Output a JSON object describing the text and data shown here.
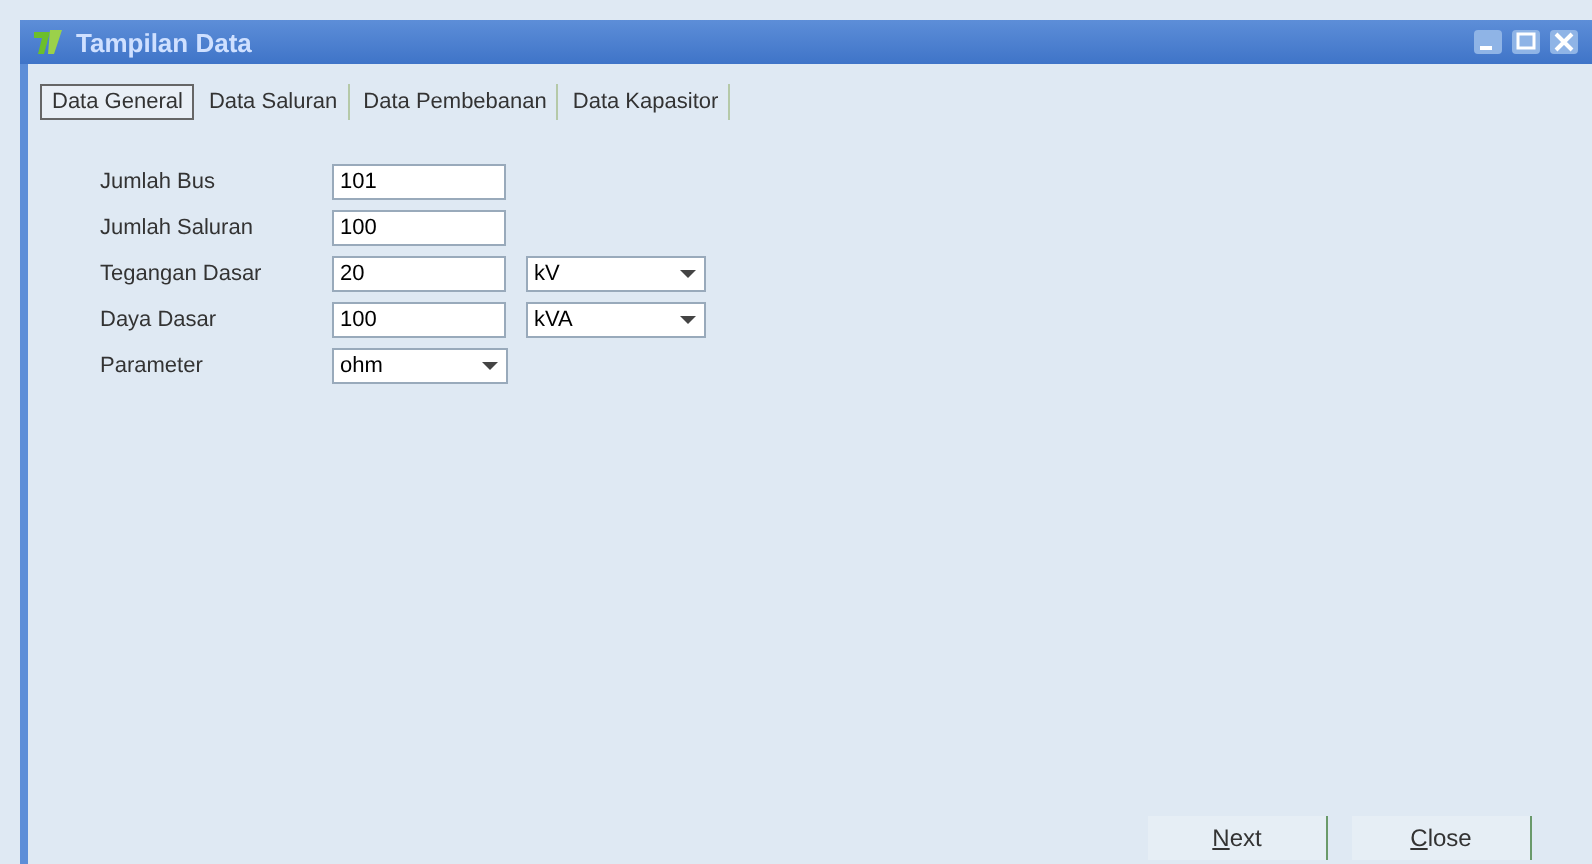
{
  "window": {
    "title": "Tampilan Data"
  },
  "tabs": [
    {
      "label": "Data General",
      "selected": true
    },
    {
      "label": "Data Saluran",
      "selected": false
    },
    {
      "label": "Data Pembebanan",
      "selected": false
    },
    {
      "label": "Data Kapasitor",
      "selected": false
    }
  ],
  "fields": [
    {
      "kind": "text",
      "label": "Jumlah Bus",
      "value": "101"
    },
    {
      "kind": "text",
      "label": "Jumlah Saluran",
      "value": "100"
    },
    {
      "kind": "text",
      "label": "Tegangan Dasar",
      "value": "20",
      "unit": "kV"
    },
    {
      "kind": "text",
      "label": "Daya Dasar",
      "value": "100",
      "unit": "kVA"
    },
    {
      "kind": "select",
      "label": "Parameter",
      "value": "ohm"
    }
  ],
  "buttons": [
    "Next",
    "Close"
  ]
}
